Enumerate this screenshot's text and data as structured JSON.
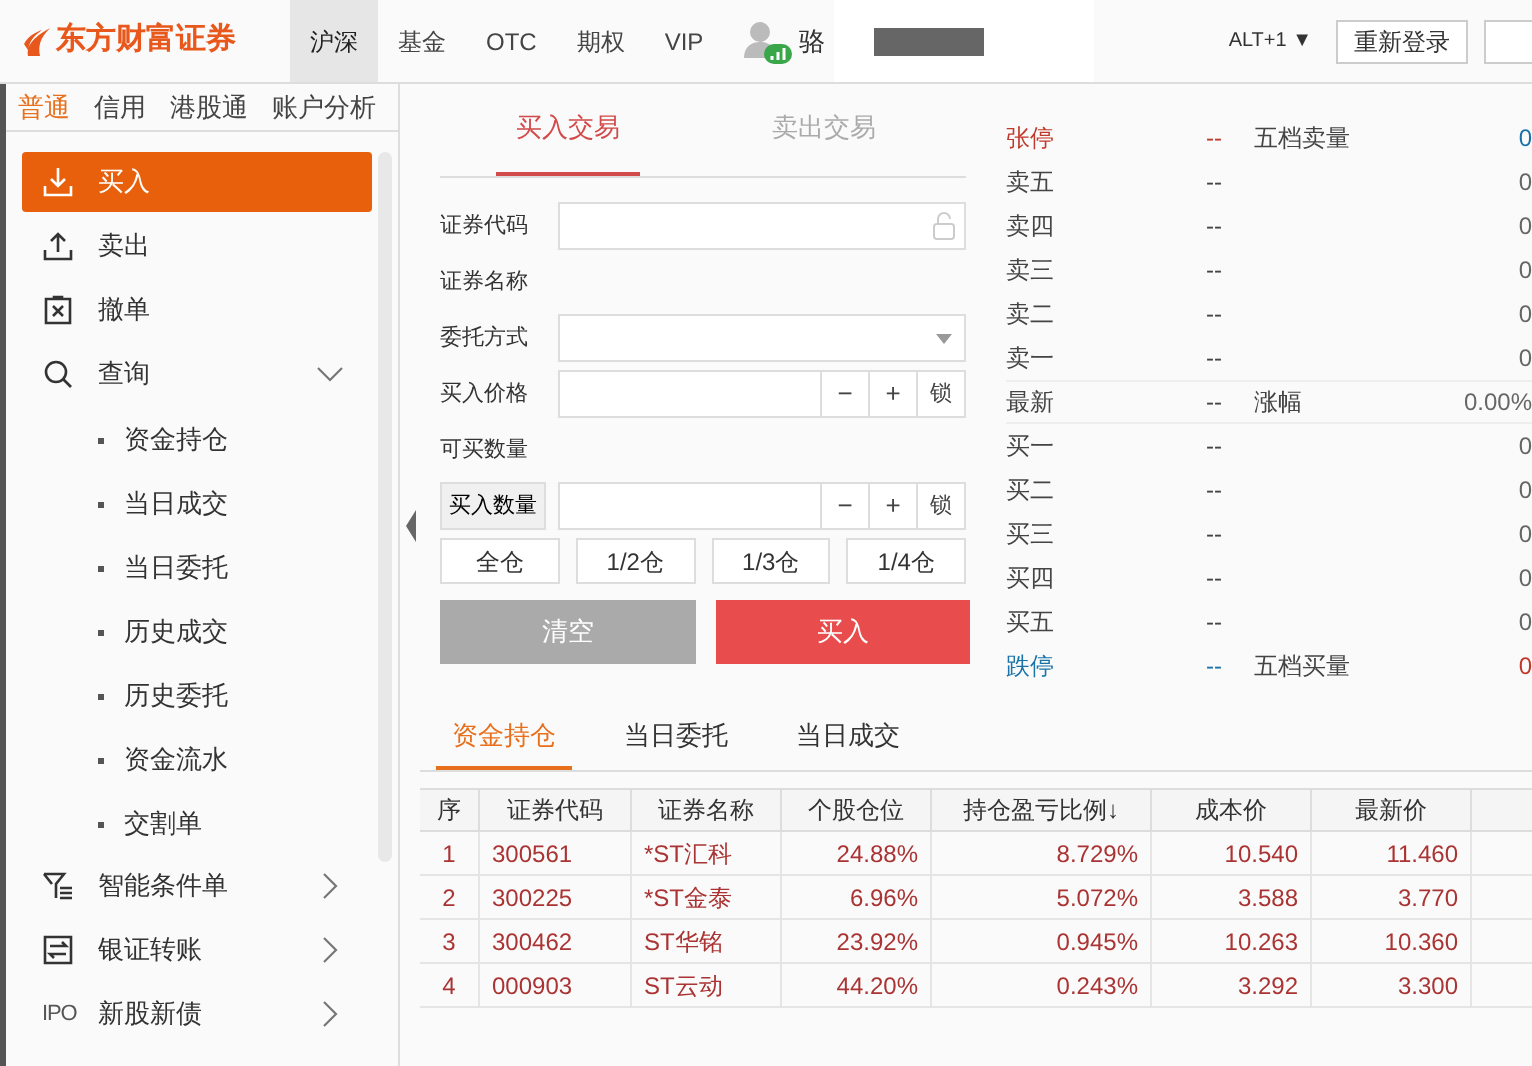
{
  "header": {
    "logo": "东方财富证券",
    "nav": [
      {
        "label": "沪深",
        "selected": true
      },
      {
        "label": "基金",
        "selected": false
      },
      {
        "label": "OTC",
        "selected": false
      },
      {
        "label": "期权",
        "selected": false
      },
      {
        "label": "VIP",
        "selected": false
      }
    ],
    "user": "骆",
    "shortcut": "ALT+1 ▼",
    "buttons": [
      "重新登录"
    ]
  },
  "sidebar": {
    "tabs": [
      {
        "label": "普通",
        "selected": true
      },
      {
        "label": "信用",
        "selected": false
      },
      {
        "label": "港股通",
        "selected": false
      },
      {
        "label": "账户分析",
        "selected": false
      }
    ],
    "items": [
      {
        "label": "买入",
        "selected": true
      },
      {
        "label": "卖出",
        "selected": false
      },
      {
        "label": "撤单",
        "selected": false
      },
      {
        "label": "查询",
        "selected": false,
        "expanded": true,
        "children": [
          {
            "label": "资金持仓"
          },
          {
            "label": "当日成交"
          },
          {
            "label": "当日委托"
          },
          {
            "label": "历史成交"
          },
          {
            "label": "历史委托"
          },
          {
            "label": "资金流水"
          },
          {
            "label": "交割单"
          }
        ]
      },
      {
        "label": "智能条件单",
        "selected": false,
        "expanded": false
      },
      {
        "label": "银证转账",
        "selected": false,
        "expanded": false
      },
      {
        "label": "新股新债",
        "icon_text": "IPO",
        "selected": false,
        "expanded": false
      }
    ]
  },
  "trade_tabs": [
    {
      "label": "买入交易",
      "selected": true
    },
    {
      "label": "卖出交易",
      "selected": false
    }
  ],
  "form": {
    "fields": [
      {
        "kind": "code",
        "label": "证券代码"
      },
      {
        "kind": "text",
        "label": "证券名称"
      },
      {
        "kind": "select",
        "label": "委托方式"
      },
      {
        "kind": "stepper",
        "label": "买入价格",
        "minus": "−",
        "plus": "+",
        "lock": "锁"
      },
      {
        "kind": "text",
        "label": "可买数量"
      },
      {
        "kind": "stepper",
        "label": "买入数量",
        "boxed": true,
        "minus": "−",
        "plus": "+",
        "lock": "锁"
      }
    ],
    "portions": [
      "全仓",
      "1/2仓",
      "1/3仓",
      "1/4仓"
    ],
    "clear": "清空",
    "submit": "买入"
  },
  "order_book": [
    {
      "kind": "limit_up",
      "label": "张停",
      "price": "--",
      "extra": "五档卖量",
      "volume": "0"
    },
    {
      "kind": "level",
      "label": "卖五",
      "price": "--",
      "volume": "0"
    },
    {
      "kind": "level",
      "label": "卖四",
      "price": "--",
      "volume": "0"
    },
    {
      "kind": "level",
      "label": "卖三",
      "price": "--",
      "volume": "0"
    },
    {
      "kind": "level",
      "label": "卖二",
      "price": "--",
      "volume": "0"
    },
    {
      "kind": "level",
      "label": "卖一",
      "price": "--",
      "volume": "0"
    },
    {
      "kind": "latest",
      "label": "最新",
      "price": "--",
      "extra": "涨幅",
      "volume": "0.00%"
    },
    {
      "kind": "level",
      "label": "买一",
      "price": "--",
      "volume": "0"
    },
    {
      "kind": "level",
      "label": "买二",
      "price": "--",
      "volume": "0"
    },
    {
      "kind": "level",
      "label": "买三",
      "price": "--",
      "volume": "0"
    },
    {
      "kind": "level",
      "label": "买四",
      "price": "--",
      "volume": "0"
    },
    {
      "kind": "level",
      "label": "买五",
      "price": "--",
      "volume": "0"
    },
    {
      "kind": "limit_down",
      "label": "跌停",
      "price": "--",
      "extra": "五档买量",
      "volume": "0"
    }
  ],
  "bottom_tabs": [
    {
      "label": "资金持仓",
      "selected": true
    },
    {
      "label": "当日委托",
      "selected": false
    },
    {
      "label": "当日成交",
      "selected": false
    }
  ],
  "table": {
    "columns": [
      "序",
      "证券代码",
      "证券名称",
      "个股仓位",
      "持仓盈亏比例↓",
      "成本价",
      "最新价"
    ],
    "rows": [
      [
        "1",
        "300561",
        "*ST汇科",
        "24.88%",
        "8.729%",
        "10.540",
        "11.460"
      ],
      [
        "2",
        "300225",
        "*ST金泰",
        "6.96%",
        "5.072%",
        "3.588",
        "3.770"
      ],
      [
        "3",
        "300462",
        "ST华铭",
        "23.92%",
        "0.945%",
        "10.263",
        "10.360"
      ],
      [
        "4",
        "000903",
        "ST云动",
        "44.20%",
        "0.243%",
        "3.292",
        "3.300"
      ]
    ]
  }
}
